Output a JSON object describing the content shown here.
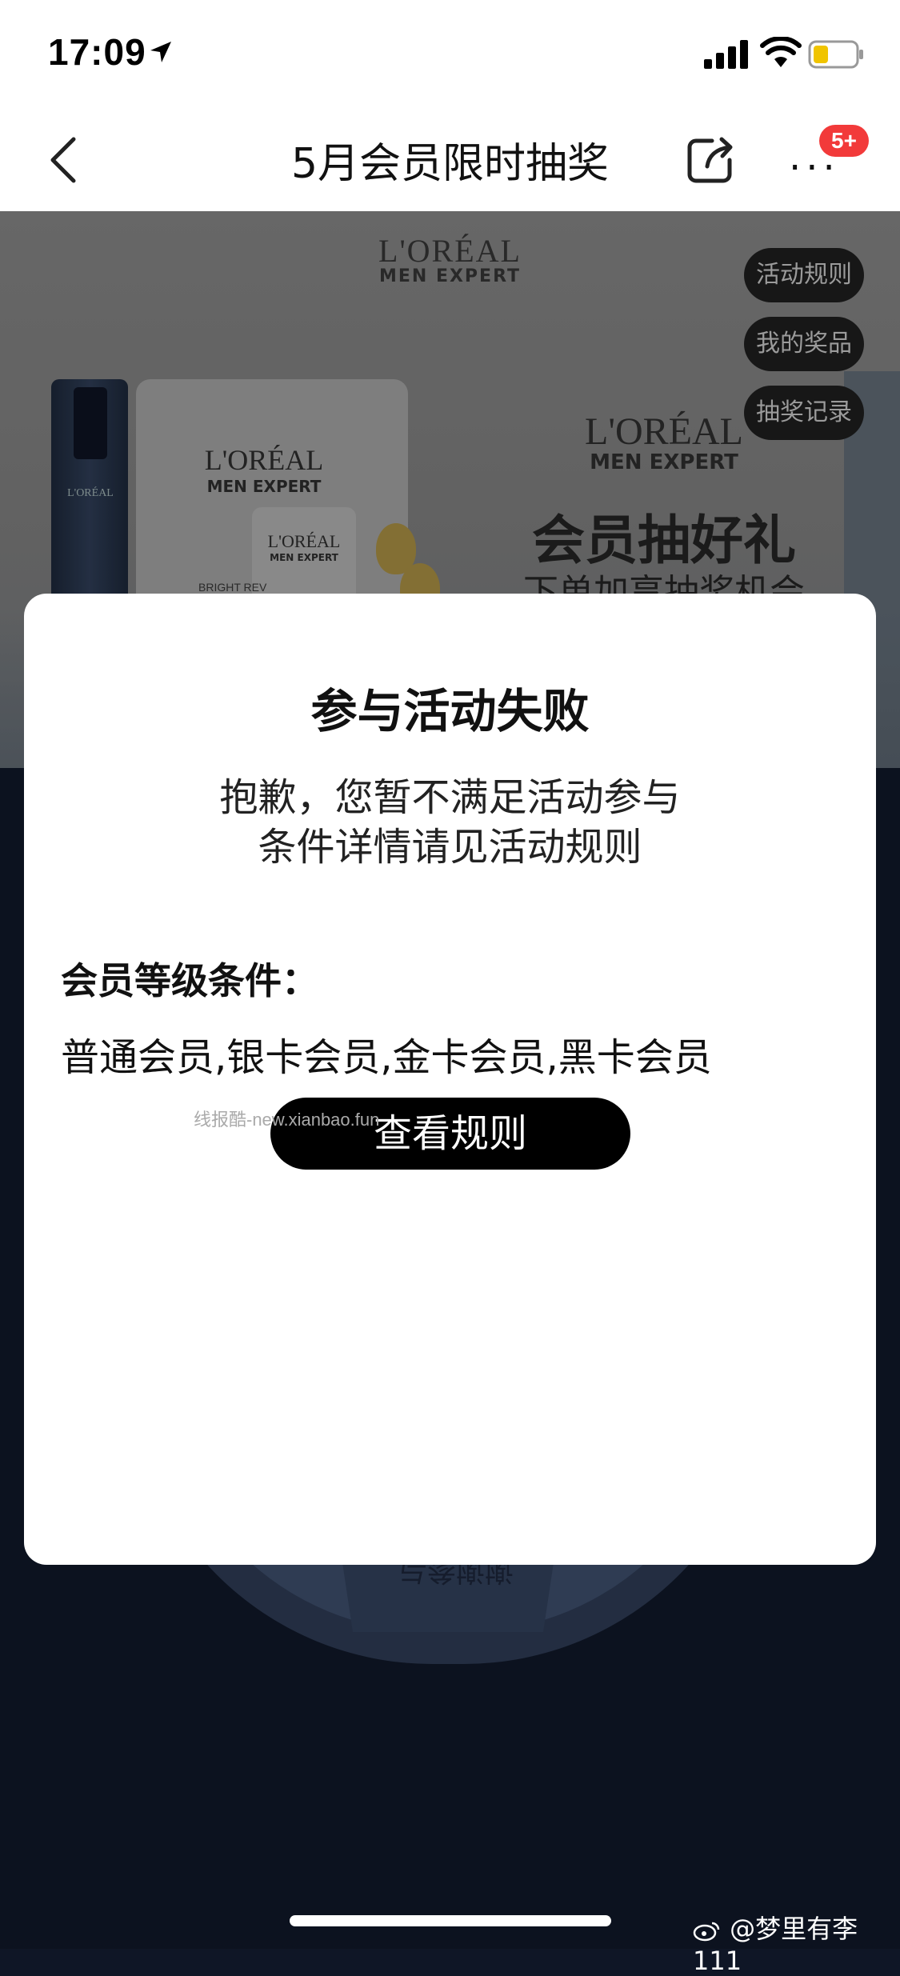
{
  "status_bar": {
    "time": "17:09"
  },
  "nav": {
    "title": "5月会员限时抽奖",
    "badge": "5+"
  },
  "banner": {
    "logo_brand": "L'ORÉAL",
    "logo_sub": "MEN EXPERT",
    "product_text": "BRIGHT REV",
    "headline": "会员抽好礼",
    "subline": "下单加享抽奖机会",
    "pills": [
      "活动规则",
      "我的奖品",
      "抽奖记录"
    ]
  },
  "wheel": {
    "text": "谢谢参与"
  },
  "modal": {
    "title": "参与活动失败",
    "message_line1": "抱歉，您暂不满足活动参与",
    "message_line2": "条件详情请见活动规则",
    "condition_label": "会员等级条件：",
    "condition_value": "普通会员,银卡会员,金卡会员,黑卡会员",
    "button_label": "查看规则",
    "watermark": "线报酷-new.xianbao.fun"
  },
  "footer": {
    "weibo_handle": "@梦里有李111"
  },
  "colors": {
    "badge": "#f23a3a",
    "button": "#000000",
    "page_bg": "#0f1626"
  }
}
